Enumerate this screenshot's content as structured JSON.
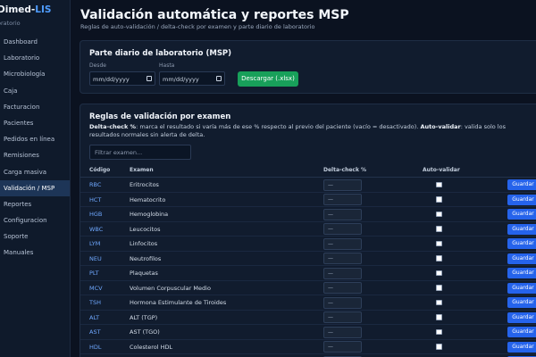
{
  "app": {
    "brand_prefix": "Dimed-",
    "brand_accent": "LIS",
    "brand_sub": "oratorio"
  },
  "sidebar": {
    "items": [
      {
        "label": "Dashboard"
      },
      {
        "label": "Laboratorio"
      },
      {
        "label": "Microbiología"
      },
      {
        "label": "Caja"
      },
      {
        "label": "Facturacion"
      },
      {
        "label": "Pacientes"
      },
      {
        "label": "Pedidos en línea"
      },
      {
        "label": "Remisiones"
      },
      {
        "label": "Carga masiva"
      },
      {
        "label": "Validación / MSP",
        "active": true
      },
      {
        "label": "Reportes"
      },
      {
        "label": "Configuracion"
      },
      {
        "label": "Soporte"
      },
      {
        "label": "Manuales"
      }
    ]
  },
  "page": {
    "title": "Validación automática y reportes MSP",
    "subtitle": "Reglas de auto-validación / delta-check por examen y parte diario de laboratorio"
  },
  "report": {
    "title": "Parte diario de laboratorio (MSP)",
    "from_label": "Desde",
    "to_label": "Hasta",
    "from_value": "mm/dd/yyyy",
    "to_value": "mm/dd/yyyy",
    "download_label": "Descargar (.xlsx)"
  },
  "rules": {
    "title": "Reglas de validación por examen",
    "desc_bold1": "Delta-check %",
    "desc_text1": ": marca el resultado si varía más de ese % respecto al previo del paciente (vacío = desactivado). ",
    "desc_bold2": "Auto-validar",
    "desc_text2": ": valida solo los resultados normales sin alerta de delta.",
    "filter_placeholder": "Filtrar examen...",
    "col_code": "Código",
    "col_exam": "Examen",
    "col_delta": "Delta-check %",
    "col_auto": "Auto-validar",
    "save_label": "Guardar",
    "delta_placeholder": "—",
    "rows": [
      {
        "code": "RBC",
        "exam": "Eritrocitos"
      },
      {
        "code": "HCT",
        "exam": "Hematocrito"
      },
      {
        "code": "HGB",
        "exam": "Hemoglobina"
      },
      {
        "code": "WBC",
        "exam": "Leucocitos"
      },
      {
        "code": "LYM",
        "exam": "Linfocitos"
      },
      {
        "code": "NEU",
        "exam": "Neutrofilos"
      },
      {
        "code": "PLT",
        "exam": "Plaquetas"
      },
      {
        "code": "MCV",
        "exam": "Volumen Corpuscular Medio"
      },
      {
        "code": "TSH",
        "exam": "Hormona Estimulante de Tiroides"
      },
      {
        "code": "ALT",
        "exam": "ALT (TGP)"
      },
      {
        "code": "AST",
        "exam": "AST (TGO)"
      },
      {
        "code": "HDL",
        "exam": "Colesterol HDL"
      },
      {
        "code": "",
        "exam": ""
      }
    ]
  }
}
